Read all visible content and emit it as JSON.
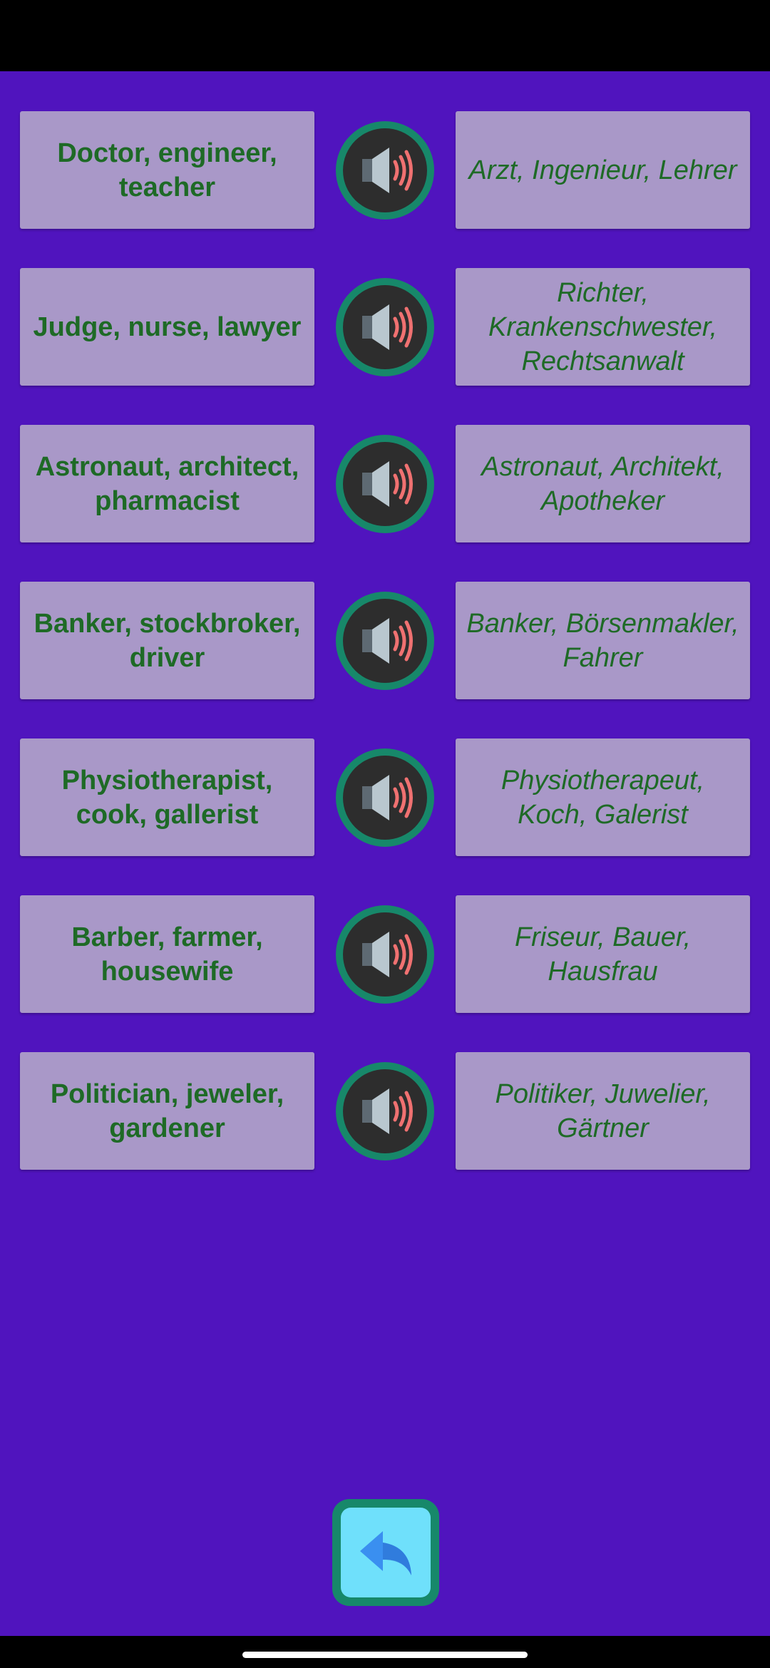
{
  "colors": {
    "background": "#5014be",
    "card": "#a998c8",
    "text": "#1e6a26",
    "speaker_ring": "#17886a",
    "back_button": "#6fe0fb"
  },
  "rows": [
    {
      "en": "Doctor, engineer, teacher",
      "de": "Arzt, Ingenieur, Lehrer"
    },
    {
      "en": "Judge, nurse, lawyer",
      "de": "Richter, Krankenschwester, Rechtsanwalt"
    },
    {
      "en": "Astronaut, architect, pharmacist",
      "de": "Astronaut, Architekt, Apotheker"
    },
    {
      "en": "Banker, stockbroker, driver",
      "de": "Banker, Börsenmakler, Fahrer"
    },
    {
      "en": "Physiotherapist, cook, gallerist",
      "de": "Physiotherapeut, Koch, Galerist"
    },
    {
      "en": "Barber, farmer, housewife",
      "de": "Friseur, Bauer, Hausfrau"
    },
    {
      "en": "Politician, jeweler, gardener",
      "de": "Politiker, Juwelier, Gärtner"
    }
  ],
  "icons": {
    "speaker": "speaker-icon",
    "back": "back-arrow-icon"
  }
}
